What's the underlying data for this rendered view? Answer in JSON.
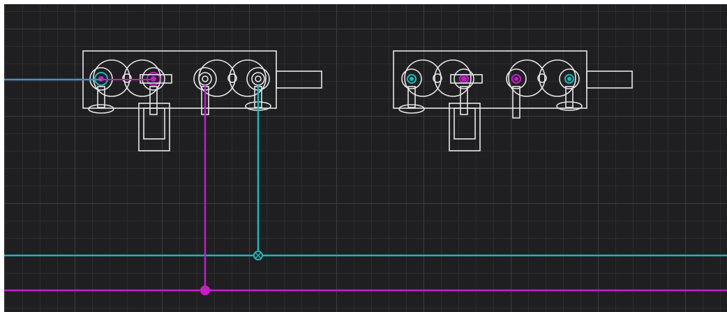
{
  "canvas": {
    "background": "#1f1f21",
    "grid_major": "#3a3d45",
    "grid_minor": "#2a2c31"
  },
  "colors": {
    "cad_outline": "#e8e8e8",
    "pipe_blue": "#4a8fc4",
    "pipe_cyan": "#1fb6bd",
    "pipe_magenta": "#c21fc9"
  },
  "assemblies": [
    {
      "name": "valve-assembly-left",
      "ports": [
        "cyan",
        "magenta",
        "white",
        "white"
      ]
    },
    {
      "name": "valve-assembly-right",
      "ports": [
        "cyan",
        "magenta",
        "magenta",
        "cyan"
      ]
    }
  ],
  "pipes": [
    {
      "name": "blue-inlet-line",
      "color": "blue"
    },
    {
      "name": "cyan-supply-line",
      "color": "cyan"
    },
    {
      "name": "magenta-supply-line",
      "color": "magenta"
    }
  ]
}
